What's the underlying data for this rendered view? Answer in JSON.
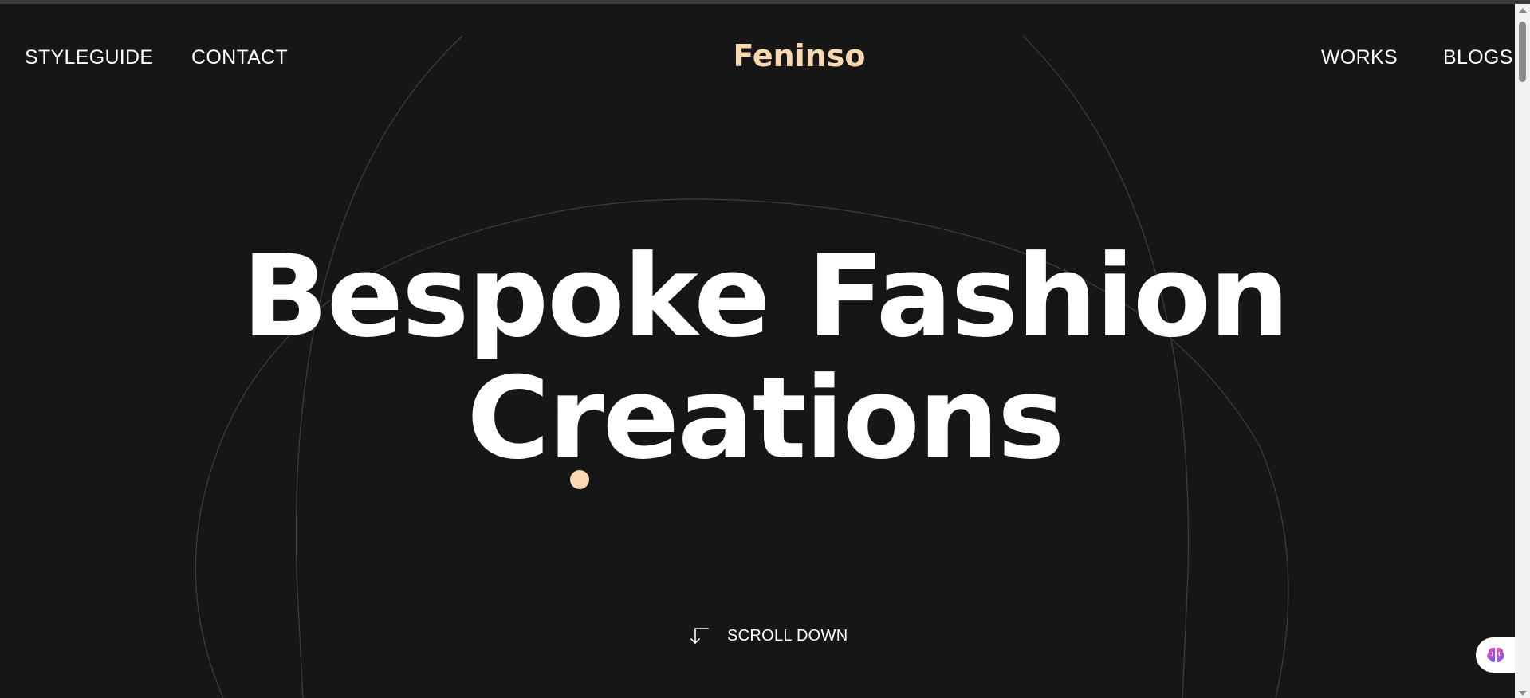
{
  "colors": {
    "background": "#161616",
    "accent": "#f9d8b2",
    "text": "#ffffff",
    "line": "#3f3f3f"
  },
  "nav": {
    "left": [
      "STYLEGUIDE",
      "CONTACT"
    ],
    "right": [
      "WORKS",
      "BLOGS"
    ]
  },
  "logo": "Feninso",
  "hero": {
    "line1": "Bespoke Fashion",
    "line2": "Creations"
  },
  "scroll": {
    "label": "SCROLL DOWN",
    "icon": "arrow-down-left-icon"
  },
  "extension_icon": "brain-icon"
}
